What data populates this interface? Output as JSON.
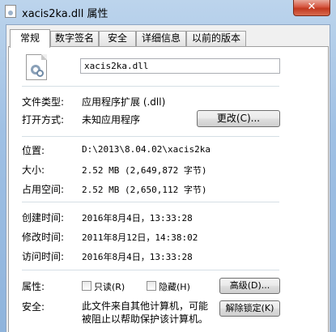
{
  "window": {
    "title": "xacis2ka.dll 属性",
    "close_label": "✕"
  },
  "tabs": [
    {
      "label": "常规",
      "active": true
    },
    {
      "label": "数字签名",
      "active": false
    },
    {
      "label": "安全",
      "active": false
    },
    {
      "label": "详细信息",
      "active": false
    },
    {
      "label": "以前的版本",
      "active": false
    }
  ],
  "general": {
    "file_name": "xacis2ka.dll",
    "file_type_label": "文件类型:",
    "file_type_value": "应用程序扩展 (.dll)",
    "open_with_label": "打开方式:",
    "open_with_value": "未知应用程序",
    "change_button": "更改(C)...",
    "location_label": "位置:",
    "location_value": "D:\\2013\\8.04.02\\xacis2ka",
    "size_label": "大小:",
    "size_value": "2.52 MB (2,649,872 字节)",
    "size_on_disk_label": "占用空间:",
    "size_on_disk_value": "2.52 MB (2,650,112 字节)",
    "created_label": "创建时间:",
    "created_value": "2016年8月4日，13:33:28",
    "modified_label": "修改时间:",
    "modified_value": "2011年8月12日，14:38:02",
    "accessed_label": "访问时间:",
    "accessed_value": "2016年8月4日，13:33:28",
    "attributes_label": "属性:",
    "readonly_label": "只读(R)",
    "readonly_checked": false,
    "hidden_label": "隐藏(H)",
    "hidden_checked": false,
    "advanced_button": "高级(D)...",
    "security_label": "安全:",
    "security_text_line1": "此文件来自其他计算机，可能",
    "security_text_line2": "被阻止以帮助保护该计算机。",
    "unblock_button": "解除锁定(K)"
  }
}
